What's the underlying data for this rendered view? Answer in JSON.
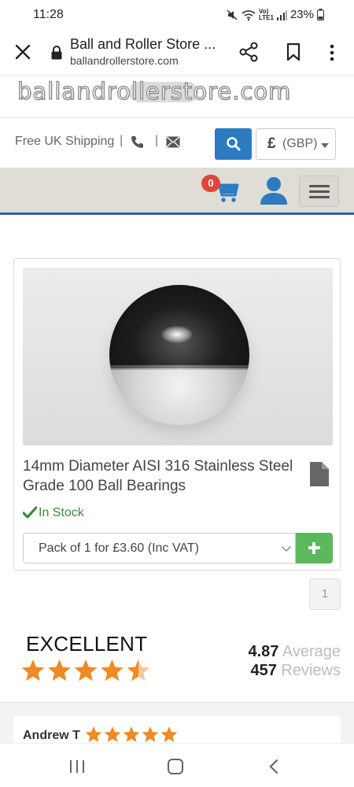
{
  "status_bar": {
    "time": "11:28",
    "network": "Vo) LTE1",
    "battery": "23%"
  },
  "browser": {
    "title": "Ball and Roller Store ...",
    "url": "ballandrollerstore.com",
    "icons": [
      "close-icon",
      "lock-icon",
      "share-icon",
      "bookmark-icon",
      "more-icon"
    ]
  },
  "header": {
    "logo_text": "ballandrollerstore.com",
    "shipping": "Free UK Shipping",
    "separator": "|",
    "currency_symbol": "£",
    "currency_code": "(GBP)"
  },
  "nav": {
    "cart_count": "0"
  },
  "product": {
    "title": "14mm Diameter AISI 316 Stainless Steel Grade 100 Ball Bearings",
    "stock": "In Stock",
    "pack_option": "Pack of 1 for £3.60 (Inc VAT)"
  },
  "pagination": {
    "current_page": "1"
  },
  "reviews_summary": {
    "rating_word": "EXCELLENT",
    "stars": 4.5,
    "average_value": "4.87",
    "average_label": "Average",
    "count_value": "457",
    "count_label": "Reviews"
  },
  "review": {
    "author": "Andrew T",
    "stars": 5
  },
  "colors": {
    "primary_blue": "#2c7bbf",
    "nav_underline": "#2d5ea8",
    "add_green": "#5cb85c",
    "star_orange": "#f08a24",
    "badge_red": "#e0473a",
    "stock_green": "#3a8a3a"
  }
}
